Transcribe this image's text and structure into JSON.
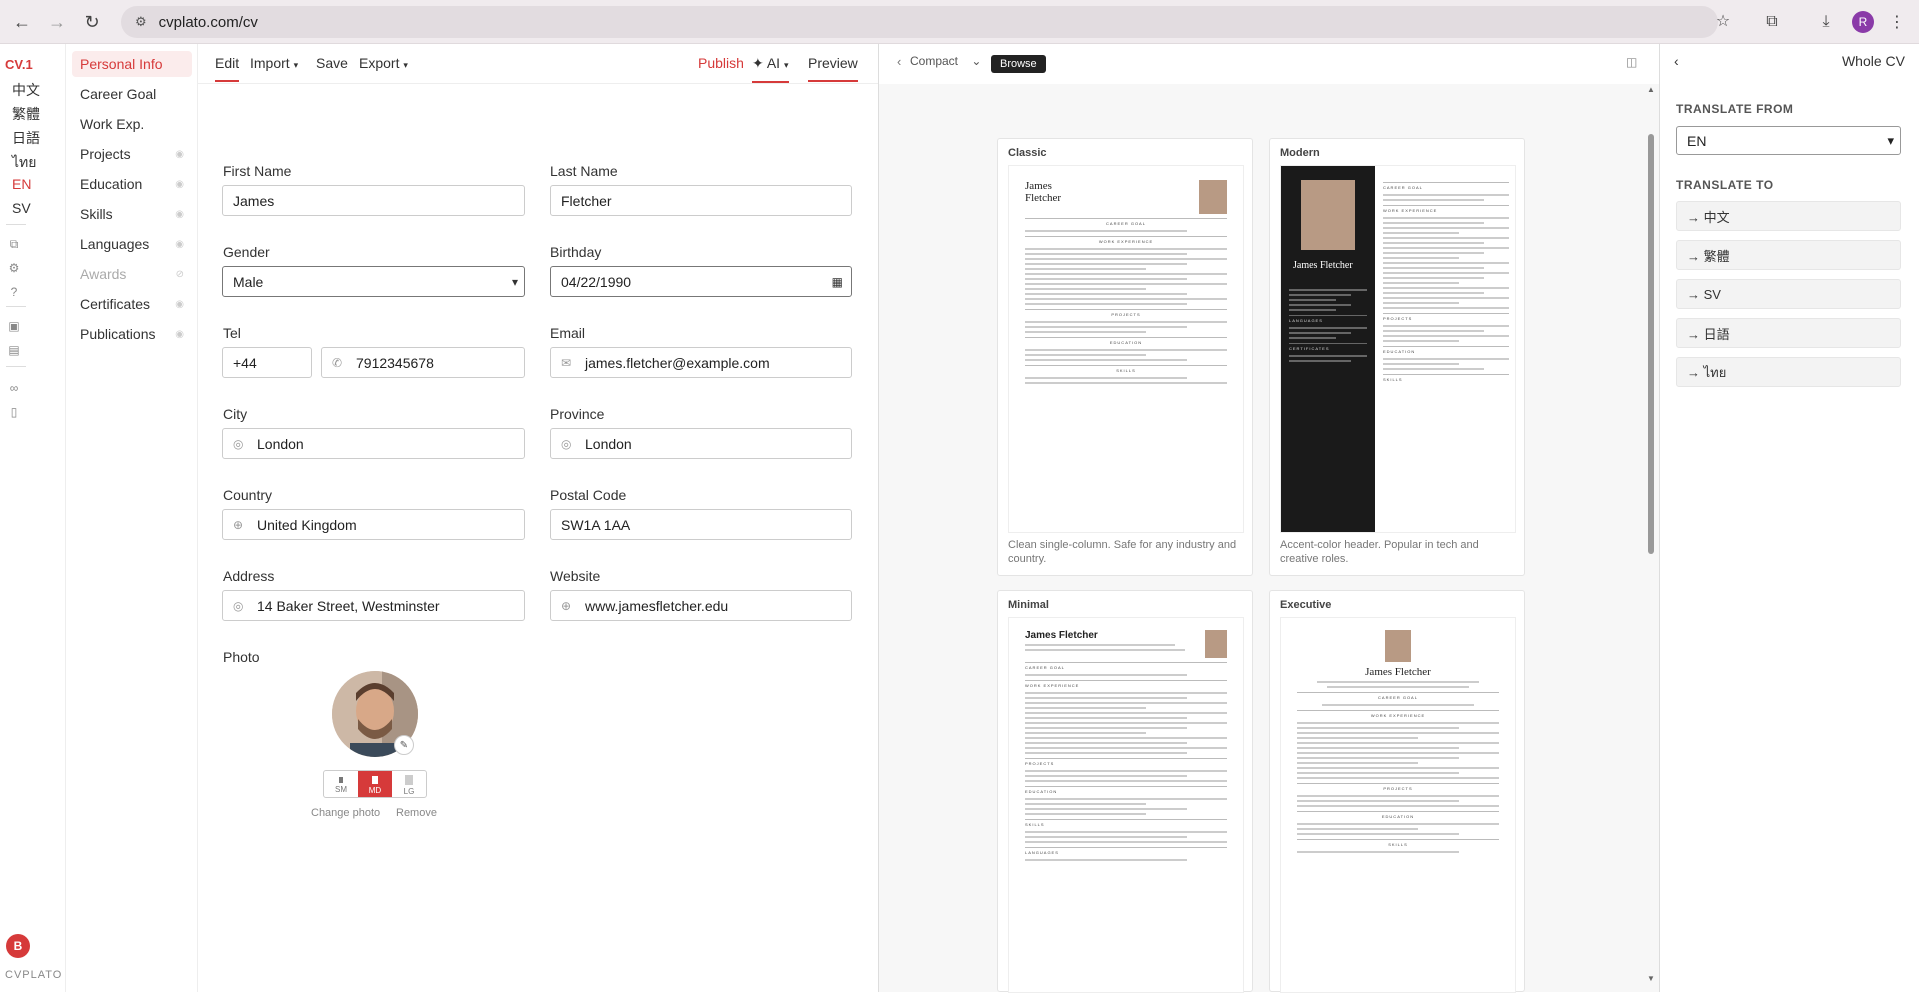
{
  "browser": {
    "url": "cvplato.com/cv",
    "profile_initial": "R"
  },
  "rail": {
    "brand": "CV.1",
    "languages": [
      "中文",
      "繁體",
      "日語",
      "ไทย",
      "EN",
      "SV"
    ],
    "active_language": "EN",
    "user_initial": "B",
    "app_name": "CVPLATO"
  },
  "sidebar": {
    "items": [
      {
        "label": "Personal Info",
        "active": true
      },
      {
        "label": "Career Goal"
      },
      {
        "label": "Work Exp."
      },
      {
        "label": "Projects"
      },
      {
        "label": "Education"
      },
      {
        "label": "Skills"
      },
      {
        "label": "Languages"
      },
      {
        "label": "Awards",
        "muted": true
      },
      {
        "label": "Certificates"
      },
      {
        "label": "Publications"
      }
    ]
  },
  "toolbar": {
    "edit": "Edit",
    "import": "Import",
    "save": "Save",
    "export": "Export",
    "publish": "Publish",
    "ai": "✦ AI",
    "preview": "Preview"
  },
  "form": {
    "first_name_label": "First Name",
    "first_name": "James",
    "last_name_label": "Last Name",
    "last_name": "Fletcher",
    "gender_label": "Gender",
    "gender": "Male",
    "birthday_label": "Birthday",
    "birthday": "04/22/1990",
    "tel_label": "Tel",
    "tel_code": "+44",
    "tel": "7912345678",
    "email_label": "Email",
    "email": "james.fletcher@example.com",
    "city_label": "City",
    "city": "London",
    "province_label": "Province",
    "province": "London",
    "country_label": "Country",
    "country": "United Kingdom",
    "postal_label": "Postal Code",
    "postal": "SW1A 1AA",
    "address_label": "Address",
    "address": "14 Baker Street, Westminster",
    "website_label": "Website",
    "website": "www.jamesfletcher.edu",
    "photo_label": "Photo",
    "sizes": [
      "SM",
      "MD",
      "LG"
    ],
    "active_size": "MD",
    "change_photo": "Change photo",
    "remove": "Remove"
  },
  "preview": {
    "mode": "Compact",
    "browse": "Browse",
    "templates": [
      {
        "name": "Classic",
        "desc": "Clean single-column. Safe for any industry and country."
      },
      {
        "name": "Modern",
        "desc": "Accent-color header. Popular in tech and creative roles."
      },
      {
        "name": "Minimal",
        "desc": ""
      },
      {
        "name": "Executive",
        "desc": ""
      }
    ],
    "cv_name": "James Fletcher",
    "cv_name_lines": [
      "James",
      "Fletcher"
    ],
    "section_titles": {
      "career_goal": "CAREER GOAL",
      "work_experience": "WORK EXPERIENCE",
      "projects": "PROJECTS",
      "education": "EDUCATION",
      "skills": "SKILLS",
      "languages": "LANGUAGES",
      "certificates": "CERTIFICATES"
    }
  },
  "translate": {
    "scope": "Whole CV",
    "from_label": "TRANSLATE FROM",
    "from_value": "EN",
    "to_label": "TRANSLATE TO",
    "targets": [
      "→ 中文",
      "→ 繁體",
      "→ SV",
      "→ 日語",
      "→ ไทย"
    ]
  },
  "colors": {
    "accent": "#d63a3a",
    "browse_bg": "#222222",
    "modern_sidebar": "#1a1a1a"
  }
}
